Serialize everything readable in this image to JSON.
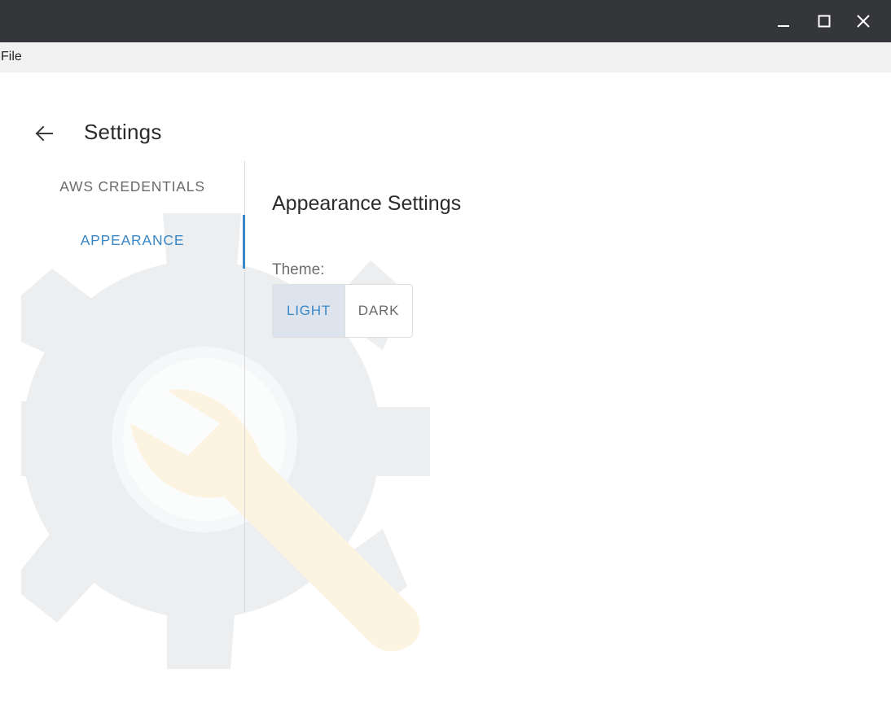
{
  "window": {
    "controls": [
      "minimize-icon",
      "maximize-icon",
      "close-icon"
    ]
  },
  "menubar": {
    "file": "File"
  },
  "header": {
    "back_icon": "arrow-left-icon",
    "title": "Settings"
  },
  "tabs": [
    {
      "label": "AWS CREDENTIALS",
      "active": false
    },
    {
      "label": "APPEARANCE",
      "active": true
    }
  ],
  "appearance": {
    "title": "Appearance Settings",
    "theme_label": "Theme:",
    "options": [
      {
        "label": "LIGHT",
        "selected": true
      },
      {
        "label": "DARK",
        "selected": false
      }
    ]
  },
  "colors": {
    "titlebar": "#35363a",
    "menubar": "#f1f1f1",
    "accent": "#3a87c8",
    "watermark_gear": "#eceef0",
    "watermark_wrench": "#fdf3e1"
  }
}
